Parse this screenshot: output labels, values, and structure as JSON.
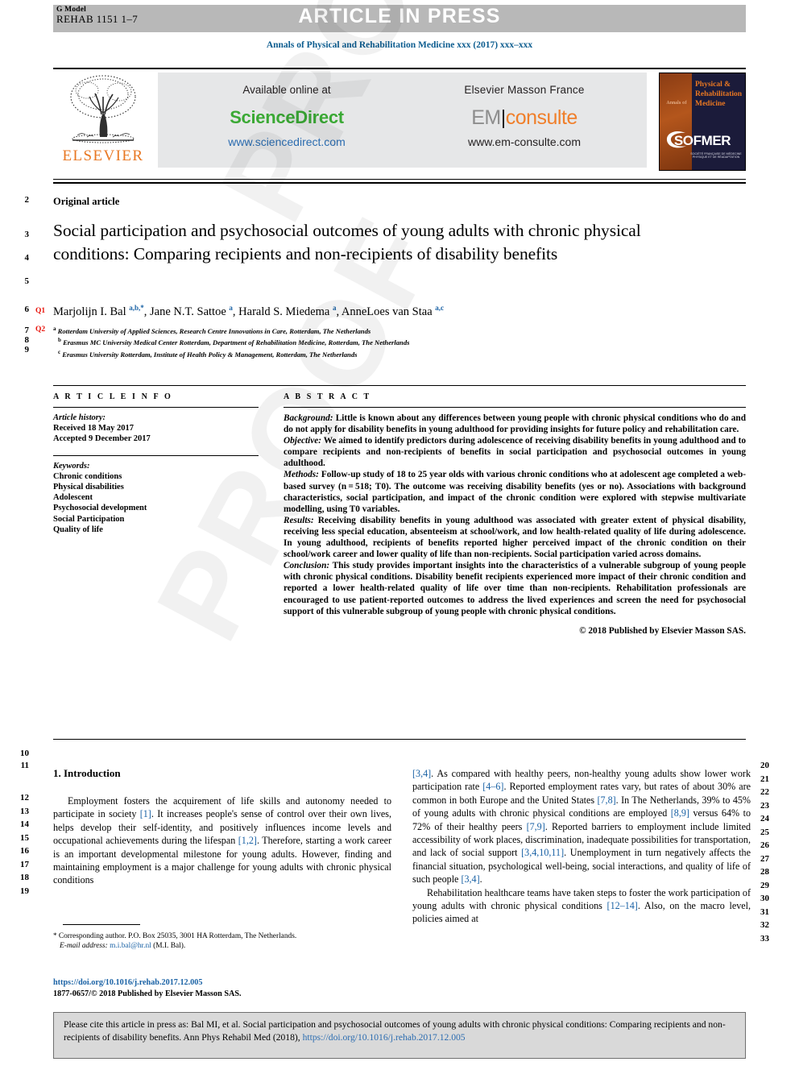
{
  "header": {
    "g_model_label": "G Model",
    "manuscript_id": "REHAB 1151 1–7",
    "article_in_press": "ARTICLE IN PRESS",
    "journal_line": "Annals of Physical and Rehabilitation Medicine xxx (2017) xxx–xxx"
  },
  "banner": {
    "elsevier_wordmark": "ELSEVIER",
    "available_online_at": "Available online at",
    "sciencedirect_name": "ScienceDirect",
    "sciencedirect_url": "www.sciencedirect.com",
    "publisher": "Elsevier Masson France",
    "em_prefix": "EM",
    "em_suffix": "consulte",
    "em_url": "www.em-consulte.com",
    "cover": {
      "annals_of": "Annals of",
      "line1": "Physical &",
      "line2": "Rehabilitation",
      "line3": "Medicine",
      "society": "SOFMER",
      "society_sub": "SOCIÉTÉ FRANÇAISE DE MÉDECINE PHYSIQUE ET DE RÉADAPTATION"
    }
  },
  "article": {
    "type_label": "Original article",
    "title": "Social participation and psychosocial outcomes of young adults with chronic physical conditions: Comparing recipients and non-recipients of disability benefits",
    "query_tags": {
      "q1": "Q1",
      "q2": "Q2"
    },
    "authors_html": "Marjolijn I. Bal <sup>a,b,*</sup>, Jane N.T. Sattoe <sup>a</sup>, Harald S. Miedema <sup>a</sup>, AnneLoes van Staa <sup>a,c</sup>",
    "affiliations": [
      {
        "marker": "a",
        "text": "Rotterdam University of Applied Sciences, Research Centre Innovations in Care, Rotterdam, The Netherlands"
      },
      {
        "marker": "b",
        "text": "Erasmus MC University Medical Center Rotterdam, Department of Rehabilitation Medicine, Rotterdam, The Netherlands"
      },
      {
        "marker": "c",
        "text": "Erasmus University Rotterdam, Institute of Health Policy & Management, Rotterdam, The Netherlands"
      }
    ]
  },
  "article_info": {
    "heading": "A R T I C L E  I N F O",
    "history_label": "Article history:",
    "received": "Received 18 May 2017",
    "accepted": "Accepted 9 December 2017",
    "keywords_label": "Keywords:",
    "keywords": [
      "Chronic conditions",
      "Physical disabilities",
      "Adolescent",
      "Psychosocial development",
      "Social Participation",
      "Quality of life"
    ]
  },
  "abstract": {
    "heading": "A B S T R A C T",
    "sections": [
      {
        "label": "Background:",
        "text": " Little is known about any differences between young people with chronic physical conditions who do and do not apply for disability benefits in young adulthood for providing insights for future policy and rehabilitation care."
      },
      {
        "label": "Objective:",
        "text": " We aimed to identify predictors during adolescence of receiving disability benefits in young adulthood and to compare recipients and non-recipients of benefits in social participation and psychosocial outcomes in young adulthood."
      },
      {
        "label": "Methods:",
        "text": " Follow-up study of 18 to 25 year olds with various chronic conditions who at adolescent age completed a web-based survey (n = 518; T0). The outcome was receiving disability benefits (yes or no). Associations with background characteristics, social participation, and impact of the chronic condition were explored with stepwise multivariate modelling, using T0 variables."
      },
      {
        "label": "Results:",
        "text": " Receiving disability benefits in young adulthood was associated with greater extent of physical disability, receiving less special education, absenteeism at school/work, and low health-related quality of life during adolescence. In young adulthood, recipients of benefits reported higher perceived impact of the chronic condition on their school/work career and lower quality of life than non-recipients. Social participation varied across domains."
      },
      {
        "label": "Conclusion:",
        "text": " This study provides important insights into the characteristics of a vulnerable subgroup of young people with chronic physical conditions. Disability benefit recipients experienced more impact of their chronic condition and reported a lower health-related quality of life over time than non-recipients. Rehabilitation professionals are encouraged to use patient-reported outcomes to address the lived experiences and screen the need for psychosocial support of this vulnerable subgroup of young people with chronic physical conditions."
      }
    ],
    "copyright": "© 2018 Published by Elsevier Masson SAS."
  },
  "body": {
    "section_heading": "1. Introduction",
    "left_paragraph_html": "Employment fosters the acquirement of life skills and autonomy needed to participate in society <span class=\"cit\">[1]</span>. It increases people's sense of control over their own lives, helps develop their self-identity, and positively influences income levels and occupational achievements during the lifespan <span class=\"cit\">[1,2]</span>. Therefore, starting a work career is an important developmental milestone for young adults. However, finding and maintaining employment is a major challenge for young adults with chronic physical conditions",
    "right_paragraph1_html": "<span class=\"cit\">[3,4]</span>. As compared with healthy peers, non-healthy young adults show lower work participation rate <span class=\"cit\">[4–6]</span>. Reported employment rates vary, but rates of about 30% are common in both Europe and the United States <span class=\"cit\">[7,8]</span>. In The Netherlands, 39% to 45% of young adults with chronic physical conditions are employed <span class=\"cit\">[8,9]</span> versus 64% to 72% of their healthy peers <span class=\"cit\">[7,9]</span>. Reported barriers to employment include limited accessibility of work places, discrimination, inadequate possibilities for transportation, and lack of social support <span class=\"cit\">[3,4,10,11]</span>. Unemployment in turn negatively affects the financial situation, psychological well-being, social interactions, and quality of life of such people <span class=\"cit\">[3,4]</span>.",
    "right_paragraph2_html": "Rehabilitation healthcare teams have taken steps to foster the work participation of young adults with chronic physical conditions <span class=\"cit\">[12–14]</span>. Also, on the macro level, policies aimed at"
  },
  "footnotes": {
    "corresponding_marker": "*",
    "corresponding_text": " Corresponding author. P.O. Box 25035, 3001 HA Rotterdam, The Netherlands.",
    "email_label": "E-mail address:",
    "email": "m.i.bal@hr.nl",
    "email_owner": "(M.I. Bal).",
    "doi": "https://doi.org/10.1016/j.rehab.2017.12.005",
    "issn_line": "1877-0657/© 2018 Published by Elsevier Masson SAS."
  },
  "cite_box": {
    "text_before": "Please cite this article in press as: Bal MI, et al. Social participation and psychosocial outcomes of young adults with chronic physical conditions: Comparing recipients and non-recipients of disability benefits. Ann Phys Rehabil Med (2018), ",
    "link": "https://doi.org/10.1016/j.rehab.2017.12.005"
  },
  "line_numbers": {
    "left": [
      "2",
      "3",
      "4",
      "5",
      "6",
      "7",
      "8",
      "9",
      "10",
      "11",
      "12",
      "13",
      "14",
      "15",
      "16",
      "17",
      "18",
      "19"
    ],
    "right": [
      "20",
      "21",
      "22",
      "23",
      "24",
      "25",
      "26",
      "27",
      "28",
      "29",
      "30",
      "31",
      "32",
      "33"
    ]
  },
  "watermark": "PROOF",
  "colors": {
    "journal_blue": "#0b5c8f",
    "link_blue": "#1a62a5",
    "sciencedirect_green": "#3ba935",
    "elsevier_orange": "#e87722",
    "query_red": "#e8140c",
    "banner_grey": "#b8b8b8"
  }
}
